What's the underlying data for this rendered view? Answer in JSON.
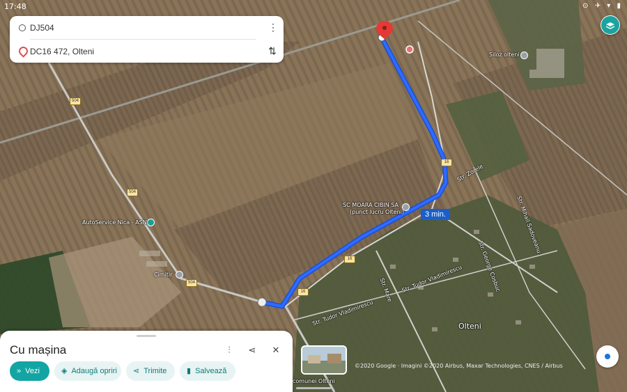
{
  "status_bar": {
    "time": "17:48",
    "icons": "⊙ ✈ ▾ ▮"
  },
  "route": {
    "from": "DJ504",
    "to": "DC16 472, Olteni"
  },
  "map_labels": {
    "siloz": "Siloz olteni",
    "autoservice": "AutoService Nica - ASN",
    "cimitir": "Cimitir",
    "moara_line1": "SC MOARA CIBIN SA",
    "moara_line2": "(punct lucru Olteni)",
    "olteni": "Olteni",
    "comunei": "comunei Olteni",
    "str_zorele": "Str. Zorele",
    "str_tudor1": "Str. Tudor Vladimirescu",
    "str_tudor2": "Str. Tudor Vladimirescu",
    "str_george": "Str. George Cosbuc",
    "str_mihail": "Str. Mihail Sadoveanu",
    "str_mare": "Str. Mare",
    "road_504": "504",
    "road_16": "16"
  },
  "route_eta": "3 min.",
  "sheet": {
    "title": "Cu mașina",
    "buttons": {
      "vezi": "Vezi",
      "adauga": "Adaugă opriri",
      "trimite": "Trimite",
      "salveaza": "Salvează"
    }
  },
  "attribution": "©2020 Google · Imagini ©2020 Airbus, Maxar Technologies, CNES / Airbus",
  "colors": {
    "route": "#2962ff",
    "accent": "#12a5a3",
    "chip_bg": "#e7f4f3",
    "destination_pin": "#e53935"
  }
}
